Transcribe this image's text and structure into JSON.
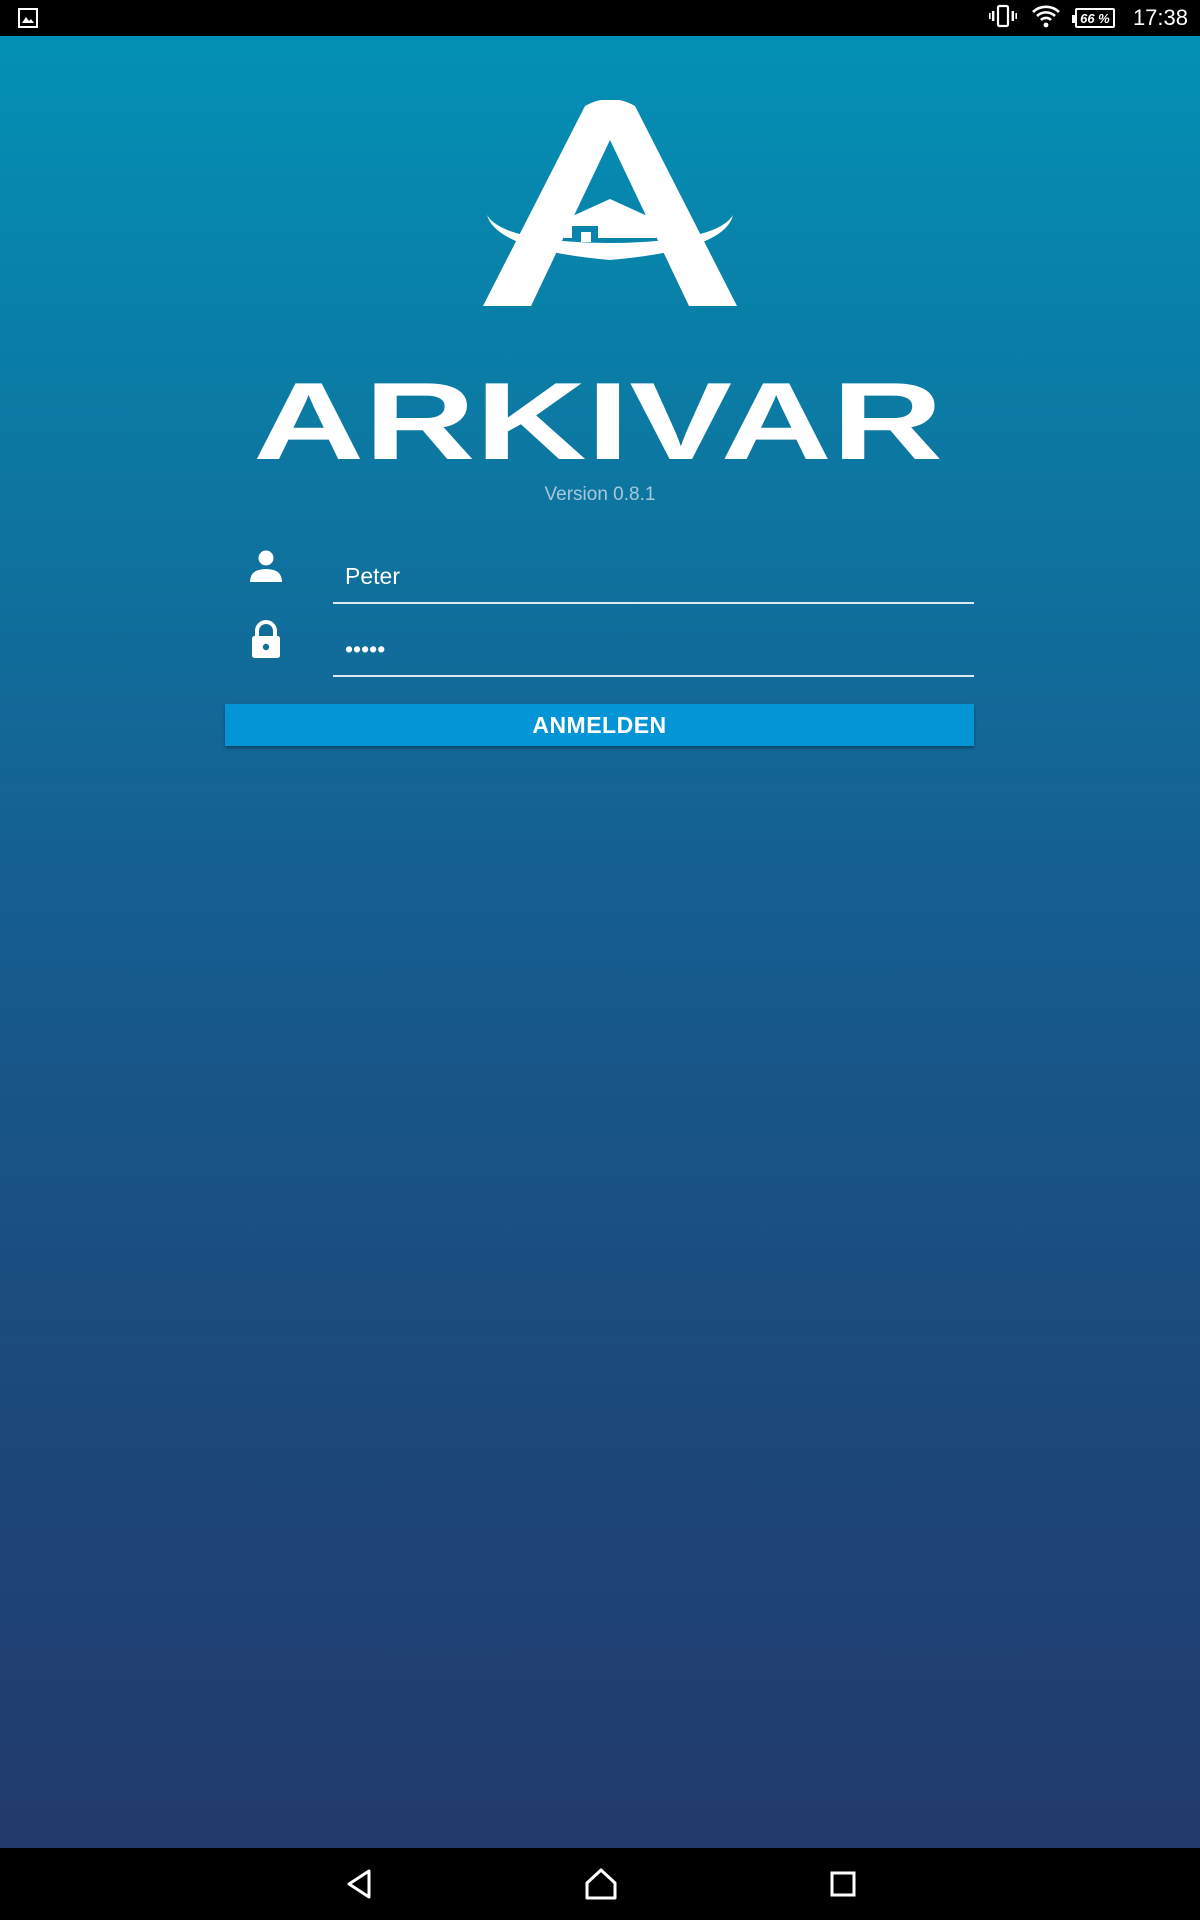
{
  "status_bar": {
    "icons": [
      "image-notification-icon",
      "vibrate-icon",
      "wifi-icon",
      "battery-icon"
    ],
    "battery": "66 %",
    "time": "17:38"
  },
  "login": {
    "brand": "ARKIVAR",
    "version": "Version 0.8.1",
    "username": {
      "value": "Peter",
      "icon": "person-icon"
    },
    "password": {
      "value": "•••••",
      "icon": "lock-icon"
    },
    "submit_label": "ANMELDEN"
  },
  "nav_bar": {
    "icons": [
      "back-icon",
      "home-icon",
      "recents-icon"
    ]
  },
  "colors": {
    "gradient_top": "#0390b5",
    "gradient_bottom": "#223a6c",
    "button": "#0495d7"
  }
}
